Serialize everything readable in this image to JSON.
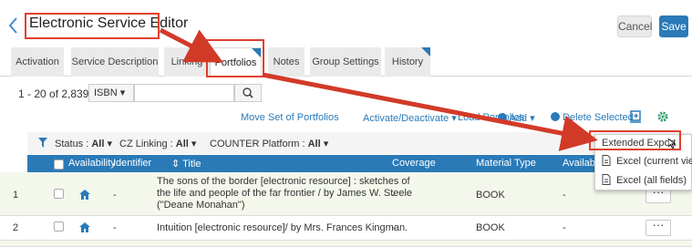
{
  "header": {
    "back_icon": "chevron-left-icon",
    "title": "Electronic Service Editor",
    "cancel_label": "Cancel",
    "save_label": "Save"
  },
  "tabs": [
    {
      "label": "Activation",
      "active": false
    },
    {
      "label": "Service Description",
      "active": false
    },
    {
      "label": "Linking",
      "active": false
    },
    {
      "label": "Portfolios",
      "active": true
    },
    {
      "label": "Notes",
      "active": false
    },
    {
      "label": "Group Settings",
      "active": false
    },
    {
      "label": "History",
      "active": false
    }
  ],
  "pager": {
    "range": "1 - 20 of 2,839",
    "search_field": "ISBN ▾",
    "search_value": ""
  },
  "actions": {
    "move": "Move Set of Portfolios",
    "activate": "Activate/Deactivate ▾",
    "load": "Load Portfolios",
    "add": "Add ▾",
    "delete": "Delete Selected"
  },
  "filters": {
    "status_label": "Status :",
    "status_value": "All",
    "cz_label": "CZ Linking :",
    "cz_value": "All",
    "counter_label": "COUNTER Platform :",
    "counter_value": "All"
  },
  "table": {
    "columns": {
      "availability": "Availability",
      "identifier": "Identifier",
      "title": "Title",
      "coverage": "Coverage",
      "material_type": "Material Type",
      "available_for": "Available F"
    },
    "rows": [
      {
        "num": "1",
        "identifier": "-",
        "title_l1": "The sons of the border [electronic resource] : sketches of",
        "title_l2": "the life and people of the far frontier / by James W. Steele",
        "title_l3": "(\"Deane Monahan\")",
        "coverage": "-",
        "material_type": "BOOK",
        "available_for": "-",
        "more": "···"
      },
      {
        "num": "2",
        "identifier": "-",
        "title_l1": "Intuition [electronic resource]/ by Mrs. Frances Kingman.",
        "coverage": "-",
        "material_type": "BOOK",
        "available_for": "-",
        "more": "···"
      }
    ]
  },
  "export_menu": {
    "label": "Extended Export",
    "items": [
      "Excel (current view)",
      "Excel (all fields)"
    ]
  },
  "colors": {
    "accent": "#2a7ab8",
    "annotation": "#e04030",
    "row_highlight": "#f4f8ec"
  }
}
